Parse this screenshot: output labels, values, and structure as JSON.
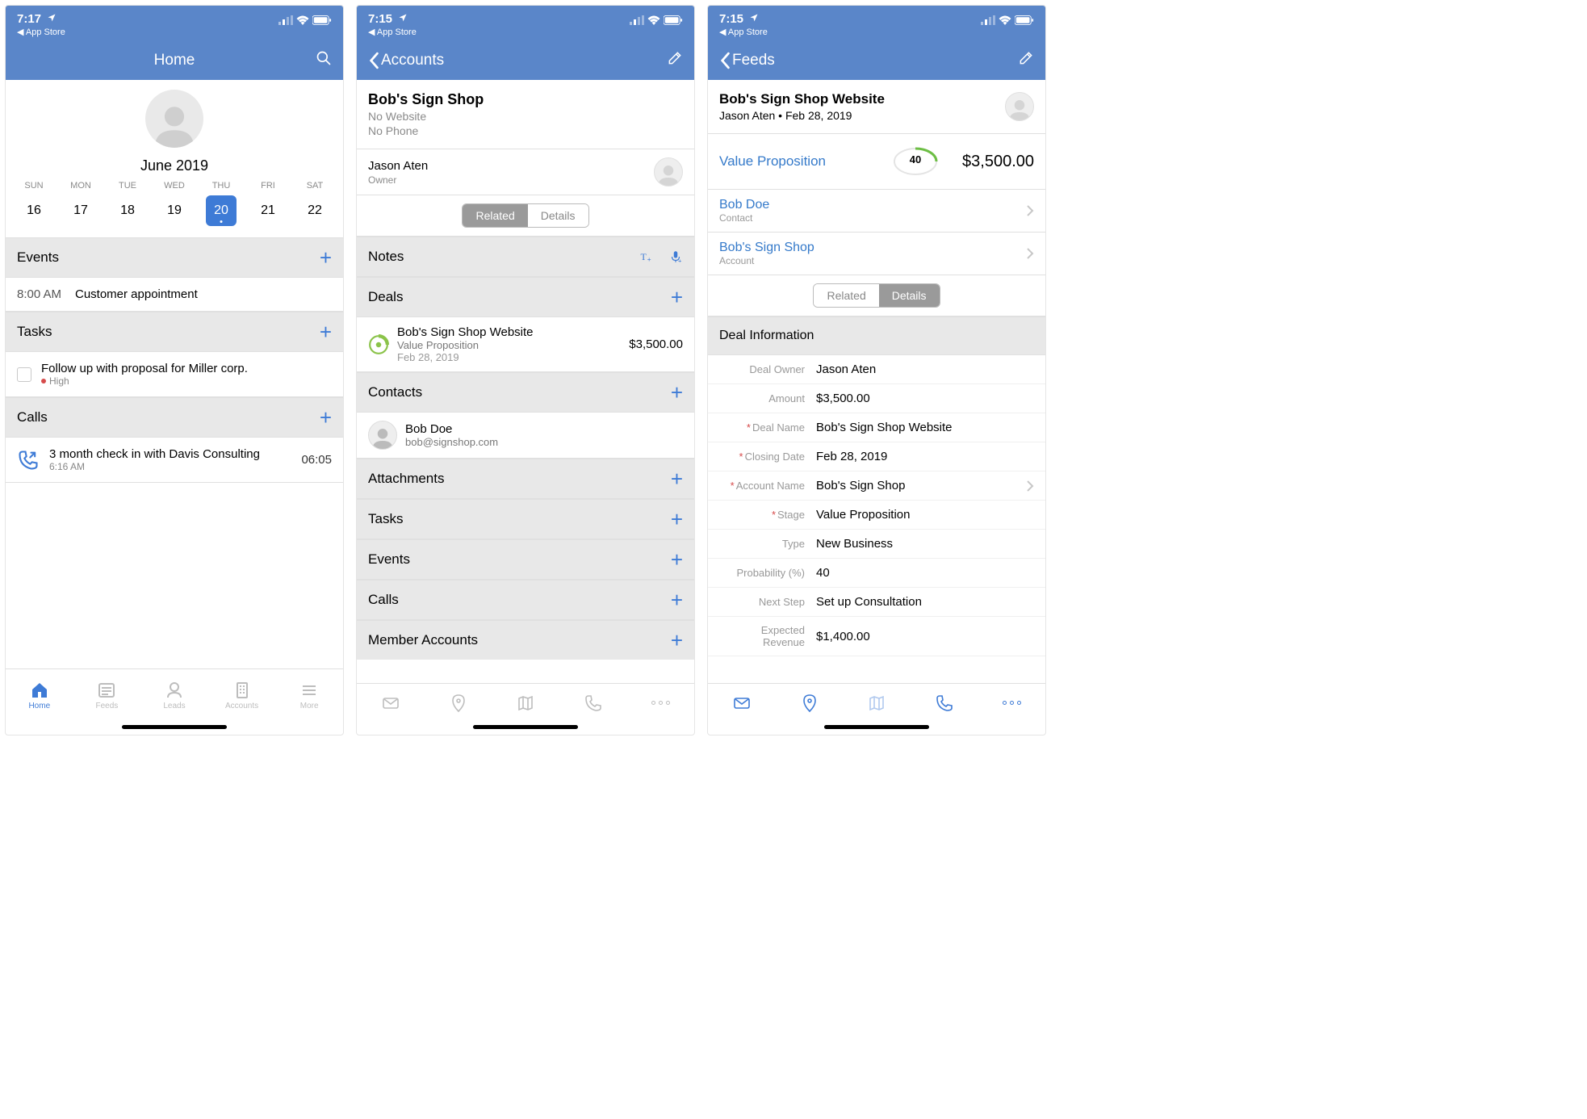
{
  "status": {
    "back": "◀ App Store"
  },
  "screen1": {
    "time": "7:17",
    "title": "Home",
    "month": "June 2019",
    "weekdays": [
      "SUN",
      "MON",
      "TUE",
      "WED",
      "THU",
      "FRI",
      "SAT"
    ],
    "days": [
      "16",
      "17",
      "18",
      "19",
      "20",
      "21",
      "22"
    ],
    "selected_day": "20",
    "events": {
      "header": "Events",
      "item_time": "8:00 AM",
      "item_title": "Customer appointment"
    },
    "tasks": {
      "header": "Tasks",
      "item_title": "Follow up with proposal for Miller corp.",
      "priority": "High"
    },
    "calls": {
      "header": "Calls",
      "item_title": "3 month check in with Davis Consulting",
      "item_sub": "6:16 AM",
      "duration": "06:05"
    },
    "tabs": [
      "Home",
      "Feeds",
      "Leads",
      "Accounts",
      "More"
    ]
  },
  "screen2": {
    "time": "7:15",
    "title": "Accounts",
    "name": "Bob's Sign Shop",
    "website": "No Website",
    "phone": "No Phone",
    "owner": "Jason Aten",
    "owner_label": "Owner",
    "seg_related": "Related",
    "seg_details": "Details",
    "notes": "Notes",
    "deals": "Deals",
    "deal_name": "Bob's Sign Shop Website",
    "deal_stage": "Value Proposition",
    "deal_date": "Feb 28, 2019",
    "deal_amount": "$3,500.00",
    "contacts": "Contacts",
    "contact_name": "Bob Doe",
    "contact_email": "bob@signshop.com",
    "sections": [
      "Attachments",
      "Tasks",
      "Events",
      "Calls",
      "Member Accounts"
    ]
  },
  "screen3": {
    "time": "7:15",
    "title": "Feeds",
    "deal_name": "Bob's Sign Shop Website",
    "meta": "Jason Aten  • Feb 28, 2019",
    "stage": "Value Proposition",
    "probability": "40",
    "amount": "$3,500.00",
    "contact_name": "Bob Doe",
    "contact_label": "Contact",
    "account_name": "Bob's Sign Shop",
    "account_label": "Account",
    "seg_related": "Related",
    "seg_details": "Details",
    "info_header": "Deal Information",
    "fields": {
      "deal_owner_l": "Deal Owner",
      "deal_owner": "Jason Aten",
      "amount_l": "Amount",
      "amount_v": "$3,500.00",
      "deal_name_l": "Deal Name",
      "deal_name_v": "Bob's Sign Shop Website",
      "closing_l": "Closing Date",
      "closing_v": "Feb 28, 2019",
      "account_l": "Account Name",
      "account_v": "Bob's Sign Shop",
      "stage_l": "Stage",
      "stage_v": "Value Proposition",
      "type_l": "Type",
      "type_v": "New Business",
      "prob_l": "Probability (%)",
      "prob_v": "40",
      "next_l": "Next Step",
      "next_v": "Set up Consultation",
      "exp_l": "Expected Revenue",
      "exp_v": "$1,400.00"
    }
  }
}
